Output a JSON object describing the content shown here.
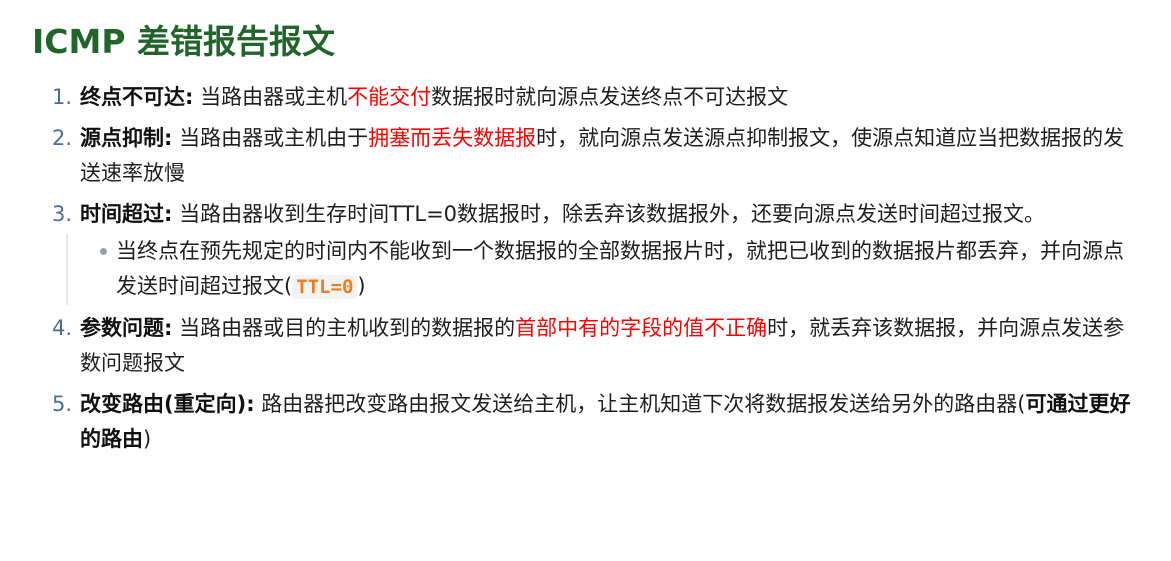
{
  "title": "ICMP 差错报告报文",
  "items": [
    {
      "num": "1.",
      "term": "终点不可达:",
      "text_before": " 当路由器或主机",
      "highlight": "不能交付",
      "text_after": "数据报时就向源点发送终点不可达报文"
    },
    {
      "num": "2.",
      "term": "源点抑制:",
      "text_before": " 当路由器或主机由于",
      "highlight": "拥塞而丢失数据报",
      "text_after": "时，就向源点发送源点抑制报文，使源点知道应当把数据报的发送速率放慢"
    },
    {
      "num": "3.",
      "term": "时间超过:",
      "text": " 当路由器收到生存时间TTL=0数据报时，除丢弃该数据报外，还要向源点发送时间超过报文。",
      "sub": {
        "text_before": "当终点在预先规定的时间内不能收到一个数据报的全部数据报片时，就把已收到的数据报片都丢弃，并向源点发送时间超过报文(",
        "code": "TTL=0",
        "text_after": ")"
      }
    },
    {
      "num": "4.",
      "term": "参数问题:",
      "text_before": " 当路由器或目的主机收到的数据报的",
      "highlight": "首部中有的字段的值不正确",
      "text_after": "时，就丢弃该数据报，并向源点发送参数问题报文"
    },
    {
      "num": "5.",
      "term": "改变路由(重定向):",
      "text_before": " 路由器把改变路由报文发送给主机，让主机知道下次将数据报发送给另外的路由器(",
      "bold": "可通过更好的路由",
      "text_after": ")"
    }
  ],
  "colors": {
    "title": "#21652b",
    "highlight": "#ff0000",
    "number": "#4a6e9b",
    "code": "#f07c1b"
  }
}
